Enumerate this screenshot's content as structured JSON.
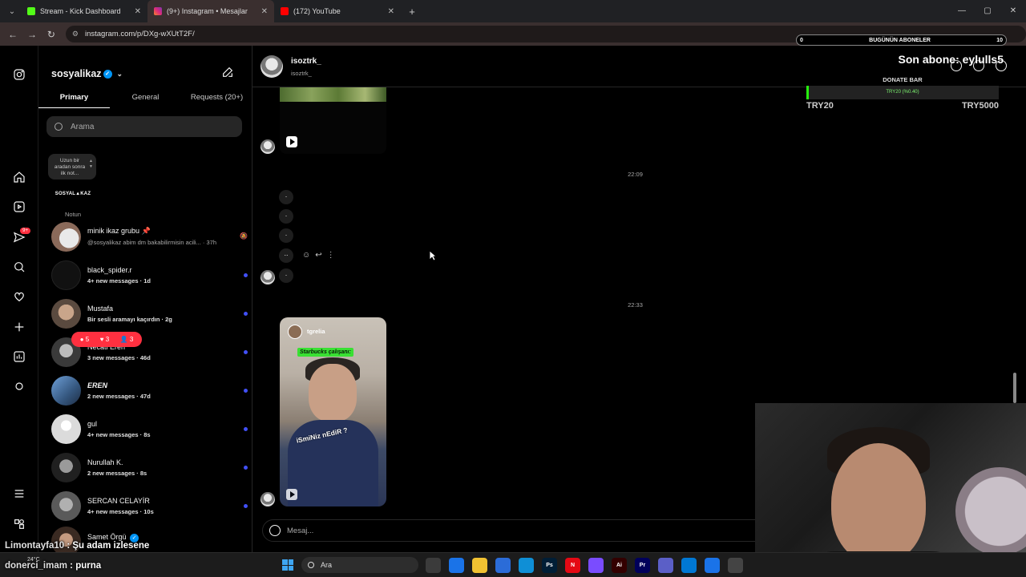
{
  "browser": {
    "tabs": [
      {
        "label": "Stream - Kick Dashboard",
        "color": "#53fc18",
        "active": false
      },
      {
        "label": "(9+) Instagram • Mesajlar",
        "color": "#e1306c",
        "active": true
      },
      {
        "label": "(172) YouTube",
        "color": "#ff0000",
        "active": false
      }
    ],
    "url": "instagram.com/p/DXg-wXUtT2F/"
  },
  "ig_nav": {
    "notif_badge": "9+"
  },
  "dm": {
    "username": "sosyalikaz",
    "tabs": [
      "Primary",
      "General",
      "Requests (20+)"
    ],
    "search_placeholder": "Arama",
    "note_text": "Uzun bir aradan sonra ilk not...",
    "note_logo": "SOSYAL▲KAZ",
    "note_label": "Notun",
    "conversations": [
      {
        "name": "minik ikaz grubu",
        "meta": "@sosyalikaz abim dm bakabilirmisin acili... · 37h",
        "unread": false,
        "pinned": true,
        "muted": true
      },
      {
        "name": "black_spider.r",
        "meta": "4+ new messages · 1d",
        "unread": true
      },
      {
        "name": "Mustafa",
        "meta": "Bir sesli aramayı kaçırdın · 2g",
        "unread": true
      },
      {
        "name": "Necati Eren",
        "meta": "3 new messages · 46d",
        "unread": true
      },
      {
        "name": "EREN",
        "meta": "2 new messages · 47d",
        "unread": true
      },
      {
        "name": "gul",
        "meta": "4+ new messages · 8s",
        "unread": true
      },
      {
        "name": "Nurullah K.",
        "meta": "2 new messages · 8s",
        "unread": true
      },
      {
        "name": "SERCAN CELAYİR",
        "meta": "4+ new messages · 10s",
        "unread": true
      },
      {
        "name": "Samet Örgü",
        "meta": "",
        "unread": false
      }
    ],
    "notif_pill": {
      "comments": "5",
      "likes": "3",
      "follows": "3"
    }
  },
  "chat": {
    "name": "isoztrk_",
    "handle": "isoztrk_",
    "timestamps": [
      "22:09",
      "22:33"
    ],
    "dot_messages": [
      ".",
      ".",
      ".",
      "..",
      "."
    ],
    "reel": {
      "user": "tgrelia",
      "tag": "Starbucks çalışanı:",
      "caption": "iSmiNiz nEdiR ?"
    },
    "composer_placeholder": "Mesaj..."
  },
  "stream": {
    "subs_left": "0",
    "subs_title": "BUGÜNÜN ABONELER",
    "subs_right": "10",
    "last_sub": "Son abone: eylulls5",
    "donate_title": "DONATE BAR",
    "donate_inner": "TRY20 (%0.40)",
    "donate_progress": 0.004,
    "donate_min": "TRY20",
    "donate_max": "TRY5000",
    "chat_lines": [
      {
        "user": "Limontayfa10",
        "text": "Şu adam izlesene"
      },
      {
        "user": "donerci_imam",
        "text": "purna"
      }
    ]
  },
  "taskbar": {
    "weather": "24°C",
    "search": "Ara",
    "apps": [
      {
        "label": "",
        "color": "#3b3b3b"
      },
      {
        "label": "",
        "color": "#1a73e8"
      },
      {
        "label": "",
        "color": "#f1c232"
      },
      {
        "label": "",
        "color": "#2b6cd8"
      },
      {
        "label": "",
        "color": "#0f8fd6"
      },
      {
        "label": "Ps",
        "color": "#001e36"
      },
      {
        "label": "N",
        "color": "#e50914"
      },
      {
        "label": "",
        "color": "#7a4cff"
      },
      {
        "label": "Ai",
        "color": "#330000"
      },
      {
        "label": "Pr",
        "color": "#00005b"
      },
      {
        "label": "",
        "color": "#5b5fc7"
      },
      {
        "label": "",
        "color": "#0078d4"
      },
      {
        "label": "",
        "color": "#1a73e8"
      },
      {
        "label": "",
        "color": "#444"
      }
    ]
  }
}
